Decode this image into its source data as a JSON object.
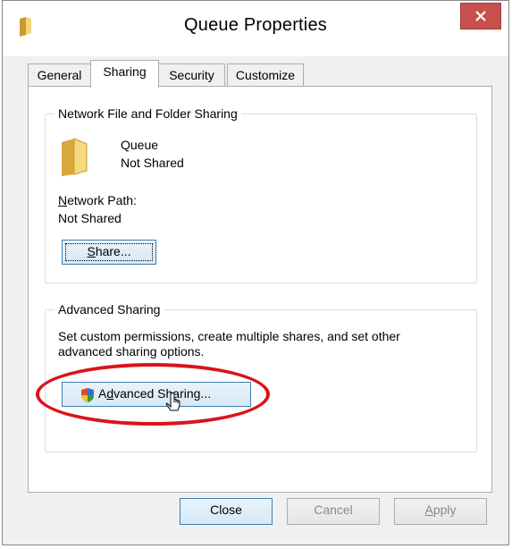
{
  "window": {
    "title": "Queue Properties"
  },
  "tabs": [
    {
      "label": "General"
    },
    {
      "label": "Sharing"
    },
    {
      "label": "Security"
    },
    {
      "label": "Customize"
    }
  ],
  "network_sharing": {
    "group_title": "Network File and Folder Sharing",
    "folder_name": "Queue",
    "folder_status": "Not Shared",
    "network_path_label_u": "N",
    "network_path_label_rest": "etwork Path:",
    "network_path_value": "Not Shared",
    "share_button_u": "S",
    "share_button_rest": "hare..."
  },
  "advanced_sharing": {
    "group_title": "Advanced Sharing",
    "description_line1": "Set custom permissions, create multiple shares, and set other",
    "description_line2": "advanced sharing options.",
    "button_pre": "A",
    "button_u": "d",
    "button_rest": "vanced Sharing..."
  },
  "footer": {
    "close_label": "Close",
    "cancel_label": "Cancel",
    "apply_u": "A",
    "apply_rest": "pply"
  },
  "colors": {
    "close_button": "#c7504f",
    "highlight_ring": "#d9141b",
    "folder": "#e8c45c"
  }
}
